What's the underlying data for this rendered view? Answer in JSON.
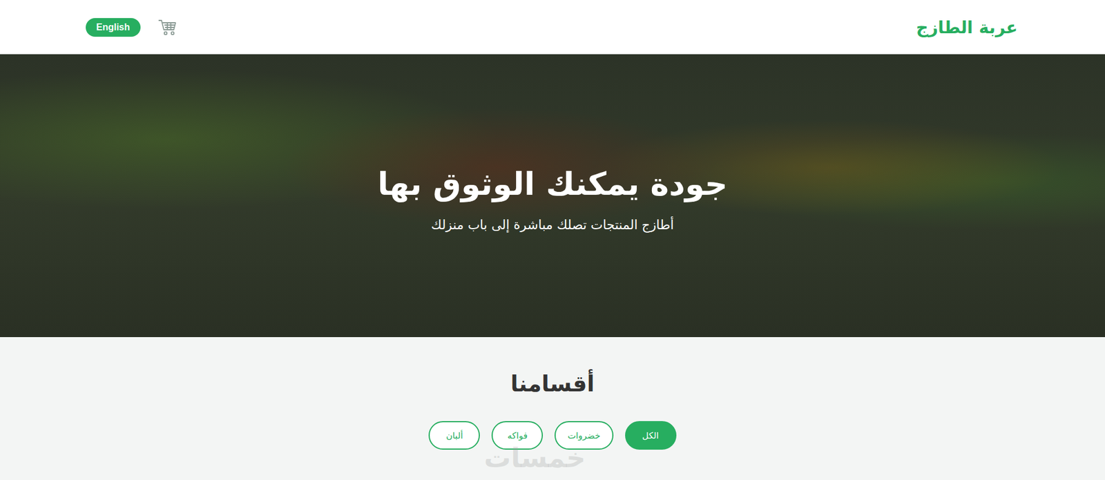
{
  "header": {
    "logo": "عربة الطازج",
    "language_button": "English"
  },
  "hero": {
    "title": "جودة يمكنك الوثوق بها",
    "subtitle": "أطازج المنتجات تصلك مباشرة إلى باب منزلك"
  },
  "categories": {
    "title": "أقسامنا",
    "filters": [
      {
        "label": "الكل",
        "selected": true
      },
      {
        "label": "خضروات",
        "selected": false
      },
      {
        "label": "فواكه",
        "selected": false
      },
      {
        "label": "ألبان",
        "selected": false
      }
    ]
  },
  "watermark": "خمسات"
}
